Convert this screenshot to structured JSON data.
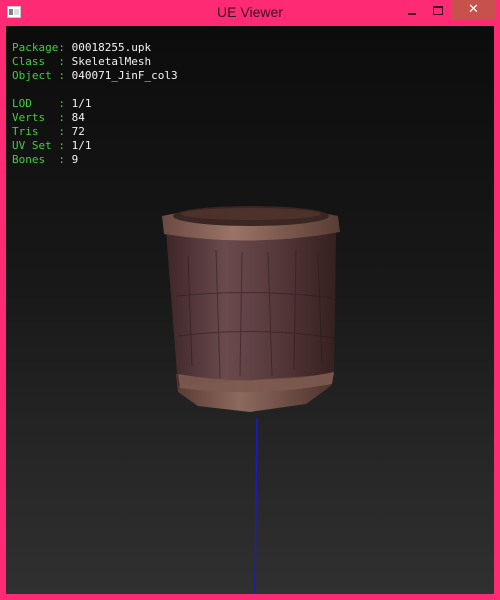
{
  "window": {
    "title": "UE Viewer",
    "controls": {
      "minimize": "minimize-icon",
      "maximize": "maximize-icon",
      "close": "close-icon"
    },
    "close_glyph": "✕"
  },
  "info": {
    "package_label": "Package:",
    "package_value": "00018255.upk",
    "class_label": "Class  :",
    "class_value": "SkeletalMesh",
    "object_label": "Object :",
    "object_value": "040071_JinF_col3",
    "lod_label": "LOD    :",
    "lod_value": "1/1",
    "verts_label": "Verts  :",
    "verts_value": "84",
    "tris_label": "Tris   :",
    "tris_value": "72",
    "uvset_label": "UV Set :",
    "uvset_value": "1/1",
    "bones_label": "Bones  :",
    "bones_value": "9"
  },
  "colors": {
    "frame": "#ff2a74",
    "label": "#3ecf3e",
    "value": "#f2f2f2",
    "bone_axis": "#1a1acc"
  }
}
